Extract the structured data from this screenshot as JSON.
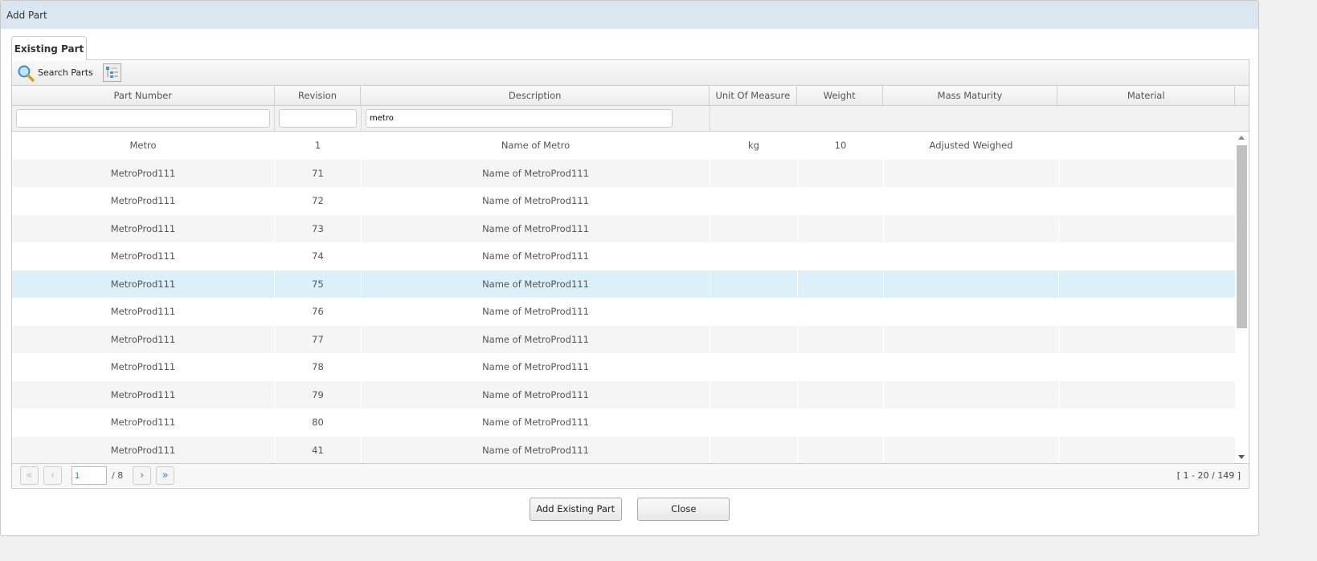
{
  "dialog": {
    "title": "Add Part"
  },
  "tab": "Existing Part",
  "toolbar": {
    "search_label": "Search Parts"
  },
  "columns": [
    "Part Number",
    "Revision",
    "Description",
    "Unit Of Measure",
    "Weight",
    "Mass Maturity",
    "Material"
  ],
  "filters": {
    "part_number": "",
    "revision": "",
    "description": "metro"
  },
  "rows": [
    [
      "Metro",
      "1",
      "Name of Metro",
      "kg",
      "10",
      "Adjusted Weighed",
      ""
    ],
    [
      "MetroProd111",
      "71",
      "Name of MetroProd111",
      "",
      "",
      "",
      ""
    ],
    [
      "MetroProd111",
      "72",
      "Name of MetroProd111",
      "",
      "",
      "",
      ""
    ],
    [
      "MetroProd111",
      "73",
      "Name of MetroProd111",
      "",
      "",
      "",
      ""
    ],
    [
      "MetroProd111",
      "74",
      "Name of MetroProd111",
      "",
      "",
      "",
      ""
    ],
    [
      "MetroProd111",
      "75",
      "Name of MetroProd111",
      "",
      "",
      "",
      ""
    ],
    [
      "MetroProd111",
      "76",
      "Name of MetroProd111",
      "",
      "",
      "",
      ""
    ],
    [
      "MetroProd111",
      "77",
      "Name of MetroProd111",
      "",
      "",
      "",
      ""
    ],
    [
      "MetroProd111",
      "78",
      "Name of MetroProd111",
      "",
      "",
      "",
      ""
    ],
    [
      "MetroProd111",
      "79",
      "Name of MetroProd111",
      "",
      "",
      "",
      ""
    ],
    [
      "MetroProd111",
      "80",
      "Name of MetroProd111",
      "",
      "",
      "",
      ""
    ],
    [
      "MetroProd111",
      "41",
      "Name of MetroProd111",
      "",
      "",
      "",
      ""
    ]
  ],
  "selected_row": 5,
  "pager": {
    "page": "1",
    "total": "/ 8",
    "info": "[ 1 - 20 / 149 ]"
  },
  "buttons": {
    "add": "Add Existing Part",
    "close": "Close"
  }
}
